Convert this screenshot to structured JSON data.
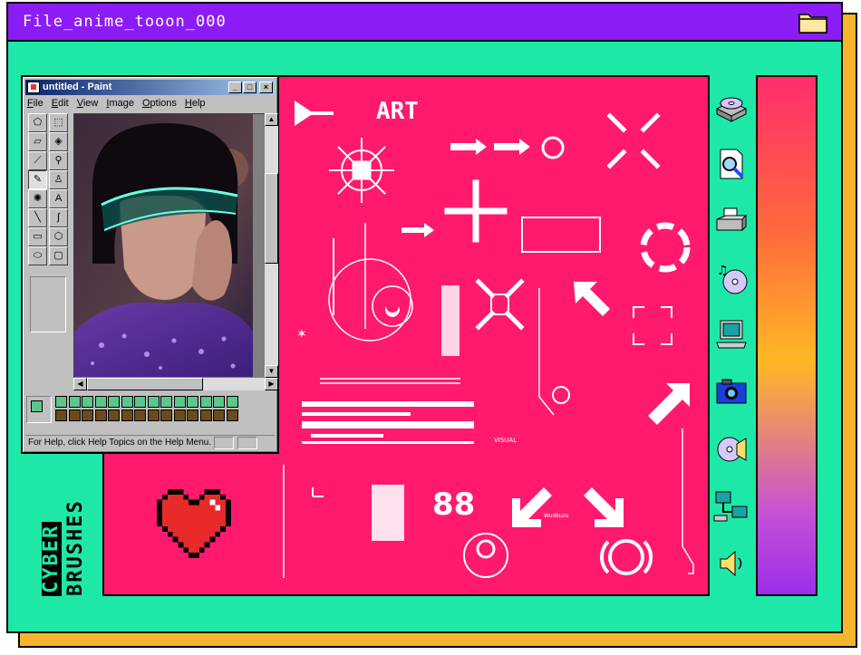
{
  "window": {
    "title": "File_anime_tooon_000",
    "folder_icon": "folder-icon"
  },
  "paint": {
    "title": "untitled - Paint",
    "window_buttons": [
      "_",
      "□",
      "×"
    ],
    "menu": [
      "File",
      "Edit",
      "View",
      "Image",
      "Options",
      "Help"
    ],
    "status": "For Help, click Help Topics on the Help Menu.",
    "fg_color": "#5cc78a",
    "bg_color": "#cfd8ff",
    "palette_top": [
      "#5cc78a",
      "#5cc78a",
      "#5cc78a",
      "#5cc78a",
      "#5cc78a",
      "#5cc78a",
      "#5cc78a",
      "#5cc78a",
      "#5cc78a",
      "#5cc78a",
      "#5cc78a",
      "#5cc78a",
      "#5cc78a",
      "#5cc78a"
    ],
    "palette_bottom": [
      "#6b4a1c",
      "#6b4a1c",
      "#6b4a1c",
      "#6b4a1c",
      "#6b4a1c",
      "#6b4a1c",
      "#6b4a1c",
      "#6b4a1c",
      "#6b4a1c",
      "#6b4a1c",
      "#6b4a1c",
      "#6b4a1c",
      "#6b4a1c",
      "#6b4a1c"
    ],
    "tools": [
      {
        "name": "free-select-icon",
        "glyph": "⬠"
      },
      {
        "name": "rect-select-icon",
        "glyph": "⬚"
      },
      {
        "name": "eraser-icon",
        "glyph": "▱"
      },
      {
        "name": "fill-icon",
        "glyph": "◈"
      },
      {
        "name": "eyedropper-icon",
        "glyph": "⟋"
      },
      {
        "name": "magnifier-icon",
        "glyph": "⚲"
      },
      {
        "name": "pencil-icon",
        "glyph": "✎"
      },
      {
        "name": "brush-icon",
        "glyph": "♙"
      },
      {
        "name": "airbrush-icon",
        "glyph": "✺"
      },
      {
        "name": "text-icon",
        "glyph": "A"
      },
      {
        "name": "line-icon",
        "glyph": "╲"
      },
      {
        "name": "curve-icon",
        "glyph": "∫"
      },
      {
        "name": "rectangle-icon",
        "glyph": "▭"
      },
      {
        "name": "polygon-icon",
        "glyph": "⬡"
      },
      {
        "name": "ellipse-icon",
        "glyph": "⬭"
      },
      {
        "name": "rounded-rect-icon",
        "glyph": "▢"
      }
    ]
  },
  "canvas": {
    "art_text": "ART",
    "small_labels": [
      "VISUAL",
      "Wudkuzu"
    ]
  },
  "side_label": {
    "word1": "CYBER",
    "word2": "BRUSHES"
  },
  "desktop_icons": [
    "cd-drive-icon",
    "find-file-icon",
    "printer-icon",
    "music-cd-icon",
    "computer-icon",
    "camera-icon",
    "cd-player-icon",
    "network-icon",
    "speaker-icon"
  ],
  "colors": {
    "main_bg": "#1ee8a8",
    "title_bar": "#8c1cf4",
    "canvas": "#ff1a6e",
    "shadow": "#f7b52c"
  }
}
